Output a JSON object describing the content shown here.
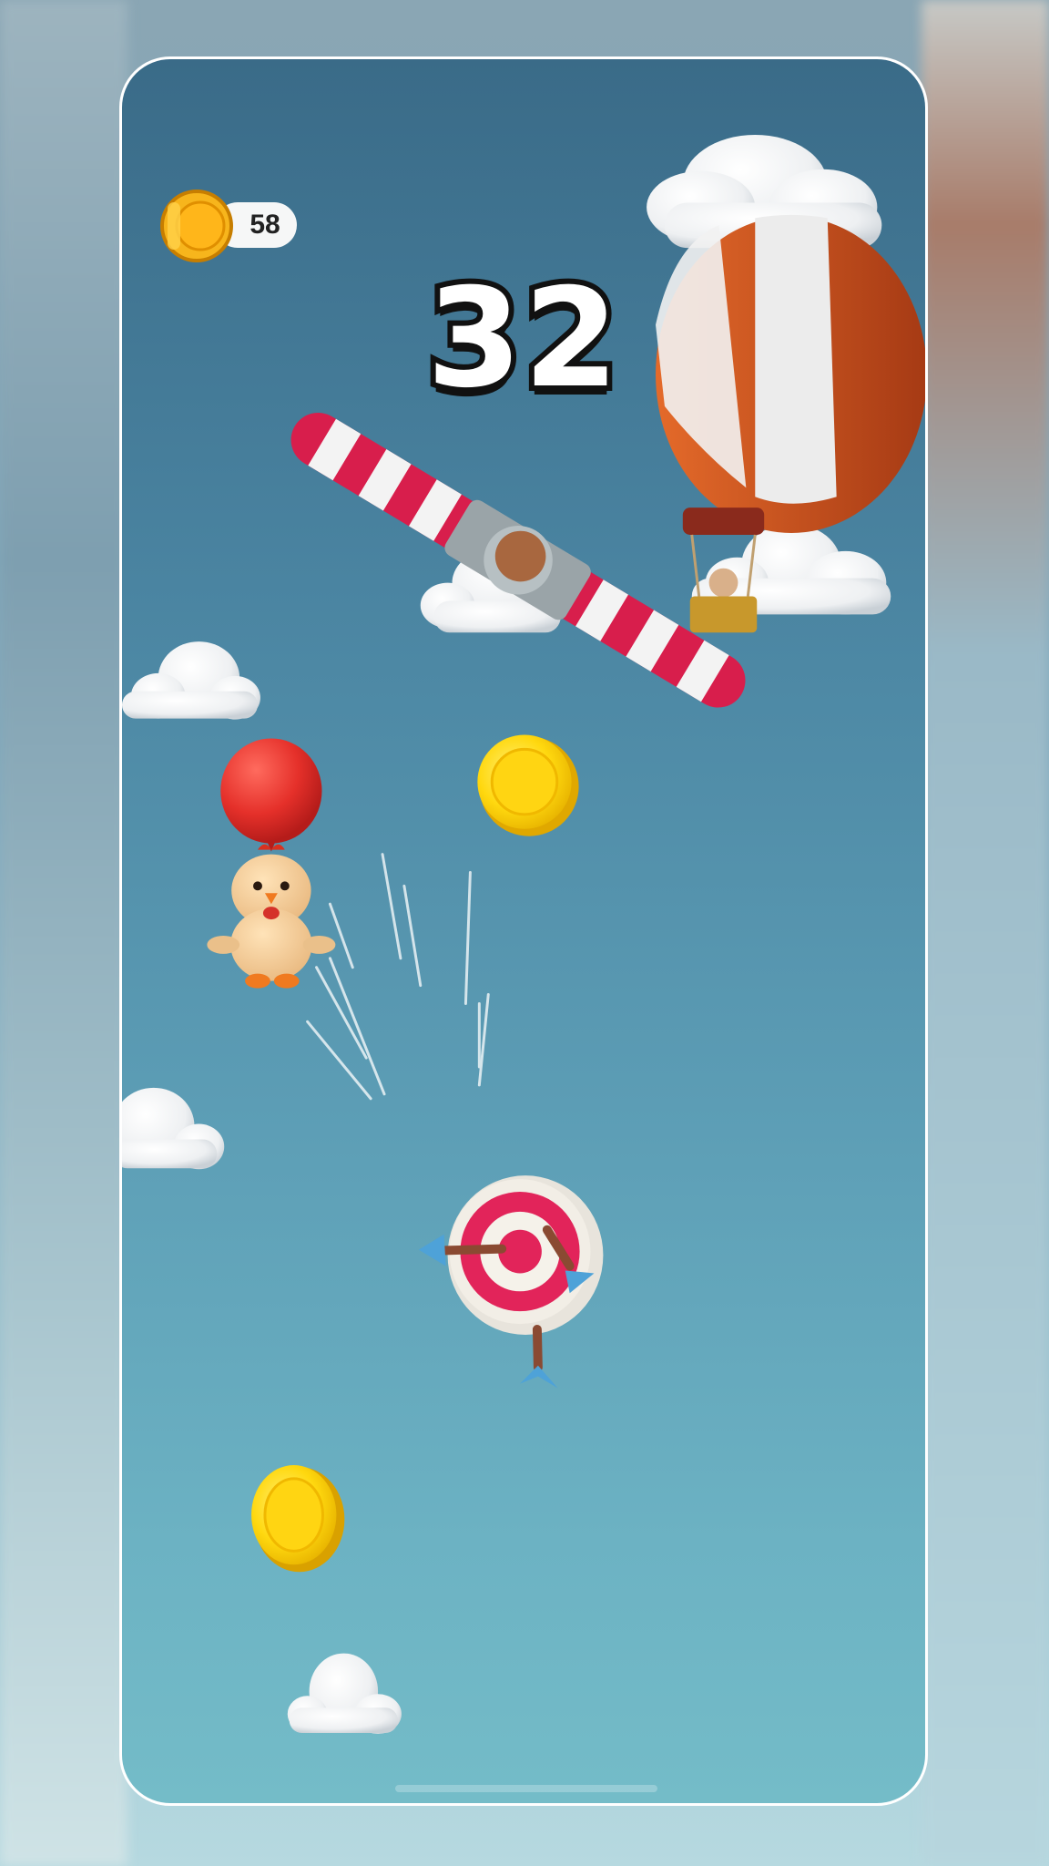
{
  "hud": {
    "coin_count": "58",
    "score": "32"
  },
  "icons": {
    "coin": "gold-coin-icon"
  },
  "colors": {
    "sky_top": "#3a6b88",
    "sky_bottom": "#74bcc8",
    "coin_gold": "#ffd21a",
    "balloon_red": "#e02a2a",
    "stripe_red": "#d81e4c"
  }
}
